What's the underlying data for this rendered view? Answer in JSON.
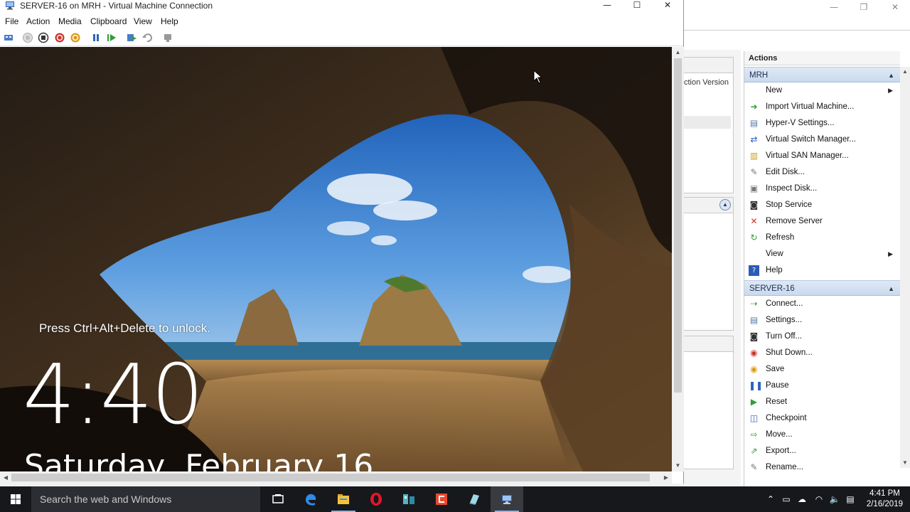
{
  "vm_window": {
    "title": "SERVER-16 on MRH - Virtual Machine Connection",
    "controls": {
      "minimize": "—",
      "maximize": "☐",
      "close": "✕"
    },
    "menu": [
      "File",
      "Action",
      "Media",
      "Clipboard",
      "View",
      "Help"
    ],
    "toolbar_icons": [
      "ctrl-alt-del-icon",
      "start-icon",
      "turn-off-icon",
      "shut-down-icon",
      "save-icon",
      "pause-icon",
      "reset-icon",
      "checkpoint-icon",
      "revert-icon",
      "enhanced-session-icon"
    ]
  },
  "guest": {
    "lock_message": "Press Ctrl+Alt+Delete to unlock.",
    "time": "4:40",
    "date": "Saturday, February 16"
  },
  "hyperv_manager": {
    "column_header": "ction Version",
    "actions_title": "Actions",
    "groups": [
      {
        "name": "MRH",
        "items": [
          {
            "label": "New",
            "icon": "blank",
            "submenu": true
          },
          {
            "label": "Import Virtual Machine...",
            "icon": "import-icon"
          },
          {
            "label": "Hyper-V Settings...",
            "icon": "settings-icon"
          },
          {
            "label": "Virtual Switch Manager...",
            "icon": "switch-icon"
          },
          {
            "label": "Virtual SAN Manager...",
            "icon": "san-icon"
          },
          {
            "label": "Edit Disk...",
            "icon": "edit-disk-icon"
          },
          {
            "label": "Inspect Disk...",
            "icon": "inspect-disk-icon"
          },
          {
            "label": "Stop Service",
            "icon": "stop-icon"
          },
          {
            "label": "Remove Server",
            "icon": "remove-icon"
          },
          {
            "label": "Refresh",
            "icon": "refresh-icon"
          },
          {
            "label": "View",
            "icon": "blank",
            "submenu": true
          },
          {
            "label": "Help",
            "icon": "help-icon"
          }
        ]
      },
      {
        "name": "SERVER-16",
        "items": [
          {
            "label": "Connect...",
            "icon": "connect-icon"
          },
          {
            "label": "Settings...",
            "icon": "vm-settings-icon"
          },
          {
            "label": "Turn Off...",
            "icon": "turn-off-icon"
          },
          {
            "label": "Shut Down...",
            "icon": "shut-down-icon"
          },
          {
            "label": "Save",
            "icon": "save-icon"
          },
          {
            "label": "Pause",
            "icon": "pause-icon"
          },
          {
            "label": "Reset",
            "icon": "reset-icon"
          },
          {
            "label": "Checkpoint",
            "icon": "checkpoint-icon"
          },
          {
            "label": "Move...",
            "icon": "move-icon"
          },
          {
            "label": "Export...",
            "icon": "export-icon"
          },
          {
            "label": "Rename...",
            "icon": "rename-icon"
          }
        ]
      }
    ]
  },
  "taskbar": {
    "search_placeholder": "Search the web and Windows",
    "apps": [
      "task-view-icon",
      "edge-icon",
      "file-explorer-icon",
      "opera-icon",
      "network-app-icon",
      "office-app-icon",
      "notes-app-icon",
      "vm-connection-icon"
    ],
    "clock_time": "4:41 PM",
    "clock_date": "2/16/2019"
  },
  "colors": {
    "accent": "#3c7fd8",
    "taskbar": "#17181c",
    "group_header": "#cfdcef"
  }
}
